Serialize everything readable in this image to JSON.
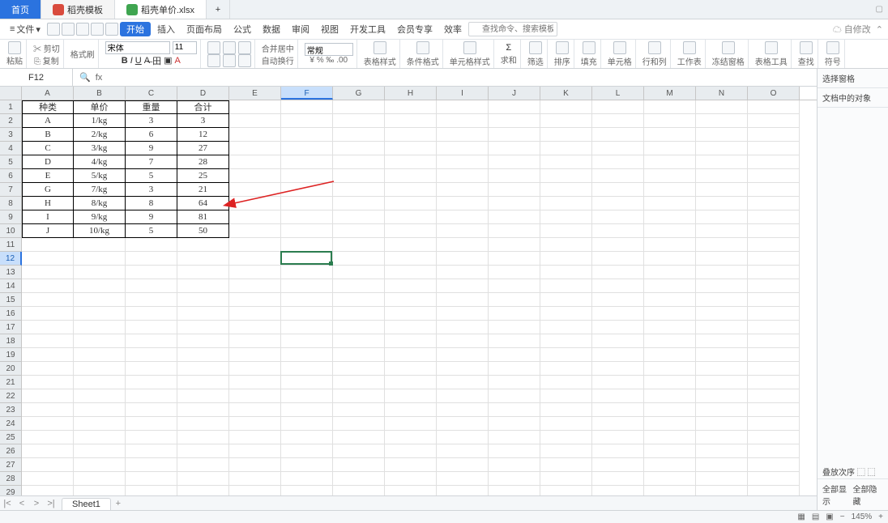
{
  "tabs": {
    "home": "首页",
    "doc": "稻壳模板",
    "sheet": "稻壳单价.xlsx",
    "add": "+"
  },
  "menu": {
    "file": "文件",
    "start": "开始",
    "insert": "插入",
    "layout": "页面布局",
    "formula": "公式",
    "data": "数据",
    "review": "审阅",
    "view": "视图",
    "dev": "开发工具",
    "member": "会员专享",
    "macro": "效率",
    "search_ph": "查找命令、搜索模板",
    "autosave": "自修改"
  },
  "ribbon": {
    "cut": "剪切",
    "copy": "复制",
    "paste": "粘贴",
    "fmtpaint": "格式刷",
    "font": "宋体",
    "size": "11",
    "wrap": "自动换行",
    "merge": "合并居中",
    "currency": "常规",
    "cfmt": "表格样式",
    "condfmt": "条件格式",
    "cellfmt": "单元格样式",
    "sum": "求和",
    "filter": "筛选",
    "sort": "排序",
    "fill": "填充",
    "cell": "单元格",
    "rowcol": "行和列",
    "sheet": "工作表",
    "freeze": "冻结窗格",
    "findtool": "表格工具",
    "find": "查找",
    "symbol": "符号"
  },
  "fbar": {
    "cell": "F12",
    "fx": "fx"
  },
  "headers": [
    "种类",
    "单价",
    "重量",
    "合计"
  ],
  "rows": [
    [
      "A",
      "1/kg",
      "3",
      "3"
    ],
    [
      "B",
      "2/kg",
      "6",
      "12"
    ],
    [
      "C",
      "3/kg",
      "9",
      "27"
    ],
    [
      "D",
      "4/kg",
      "7",
      "28"
    ],
    [
      "E",
      "5/kg",
      "5",
      "25"
    ],
    [
      "G",
      "7/kg",
      "3",
      "21"
    ],
    [
      "H",
      "8/kg",
      "8",
      "64"
    ],
    [
      "I",
      "9/kg",
      "9",
      "81"
    ],
    [
      "J",
      "10/kg",
      "5",
      "50"
    ]
  ],
  "cols": [
    "A",
    "B",
    "C",
    "D",
    "E",
    "F",
    "G",
    "H",
    "I",
    "J",
    "K",
    "L",
    "M",
    "N",
    "O"
  ],
  "rpanel": {
    "title": "选择窗格",
    "subtitle": "文档中的对象",
    "stack": "叠放次序",
    "showall": "全部显示",
    "hideall": "全部隐藏"
  },
  "sheet": {
    "name": "Sheet1"
  },
  "status": {
    "zoom": "145%"
  },
  "chart_data": {
    "type": "table",
    "columns": [
      "种类",
      "单价",
      "重量",
      "合计"
    ],
    "records": [
      {
        "种类": "A",
        "单价": "1/kg",
        "重量": 3,
        "合计": 3
      },
      {
        "种类": "B",
        "单价": "2/kg",
        "重量": 6,
        "合计": 12
      },
      {
        "种类": "C",
        "单价": "3/kg",
        "重量": 9,
        "合计": 27
      },
      {
        "种类": "D",
        "单价": "4/kg",
        "重量": 7,
        "合计": 28
      },
      {
        "种类": "E",
        "单价": "5/kg",
        "重量": 5,
        "合计": 25
      },
      {
        "种类": "G",
        "单价": "7/kg",
        "重量": 3,
        "合计": 21
      },
      {
        "种类": "H",
        "单价": "8/kg",
        "重量": 8,
        "合计": 64
      },
      {
        "种类": "I",
        "单价": "9/kg",
        "重量": 9,
        "合计": 81
      },
      {
        "种类": "J",
        "单价": "10/kg",
        "重量": 5,
        "合计": 50
      }
    ]
  }
}
